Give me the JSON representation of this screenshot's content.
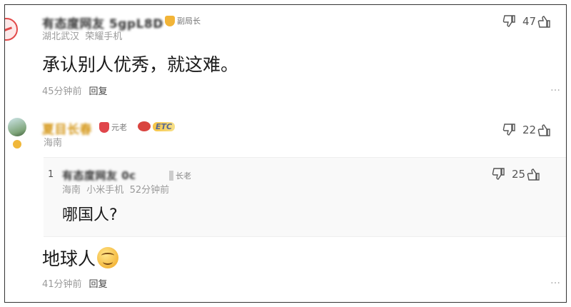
{
  "comment1": {
    "username": "有态度网友 5gpL8D",
    "badge": "副局长",
    "location": "湖北武汉",
    "device": "荣耀手机",
    "text": "承认别人优秀，就这难。",
    "time": "45分钟前",
    "reply_label": "回复",
    "likes": "47"
  },
  "comment2": {
    "username": "夏目长春",
    "badge1": "元老",
    "badge2": "ETC",
    "location": "海南",
    "likes": "22",
    "quote": {
      "index": "1",
      "username": "有态度网友 0c",
      "badge": "长老",
      "location": "海南",
      "device": "小米手机",
      "time": "52分钟前",
      "text": "哪国人?",
      "likes": "25"
    },
    "text": "地球人",
    "time": "41分钟前",
    "reply_label": "回复"
  },
  "more_icon": "…",
  "colors": {
    "badge_gold": "#f2b437",
    "badge_red": "#e0464b",
    "meta_gray": "#9a9a9a"
  }
}
